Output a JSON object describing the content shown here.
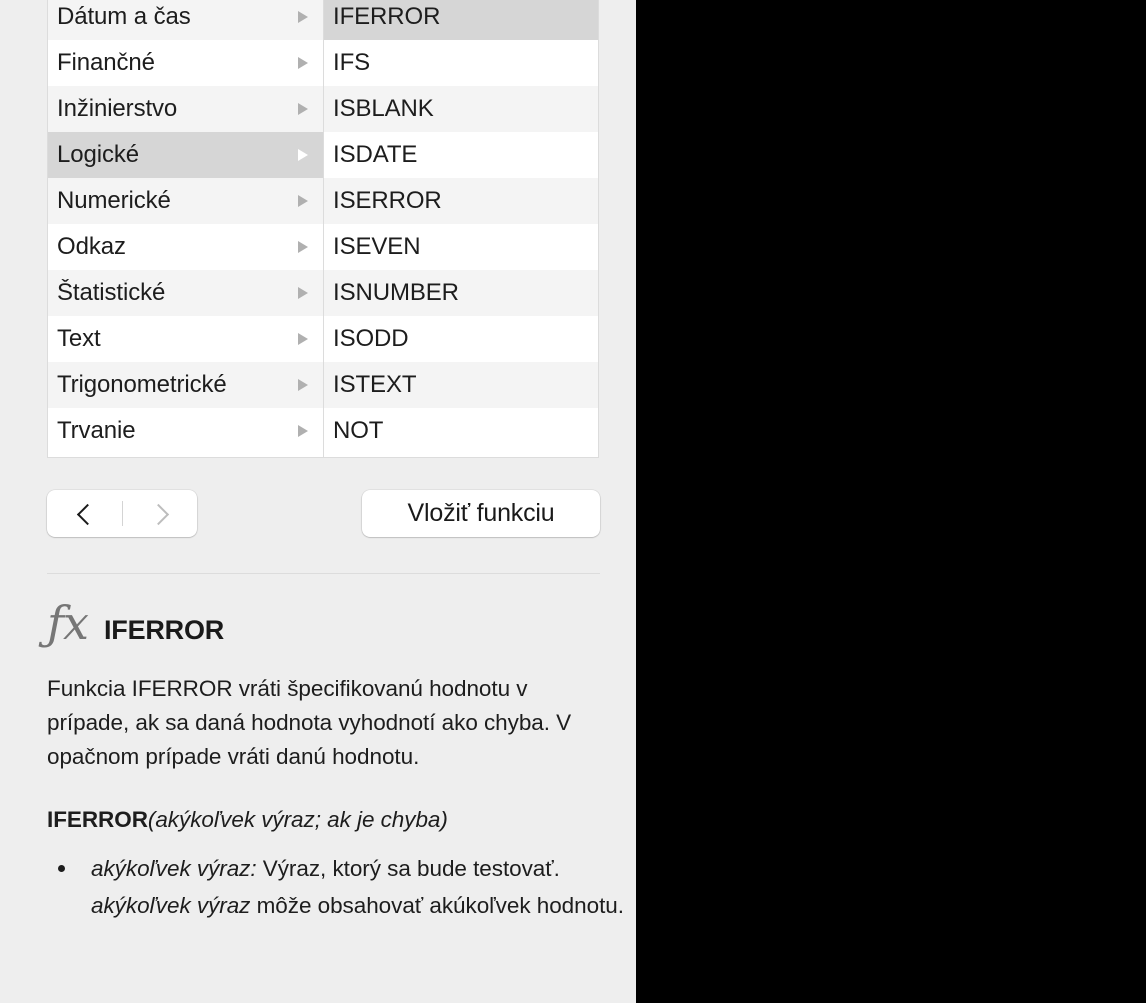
{
  "panel": {
    "background_color": "#eeeeee",
    "outside_color": "#000000"
  },
  "browser": {
    "categories_header": "",
    "categories": [
      {
        "label": "Dátum a čas",
        "selected": false
      },
      {
        "label": "Finančné",
        "selected": false
      },
      {
        "label": "Inžinierstvo",
        "selected": false
      },
      {
        "label": "Logické",
        "selected": true
      },
      {
        "label": "Numerické",
        "selected": false
      },
      {
        "label": "Odkaz",
        "selected": false
      },
      {
        "label": "Štatistické",
        "selected": false
      },
      {
        "label": "Text",
        "selected": false
      },
      {
        "label": "Trigonometrické",
        "selected": false
      },
      {
        "label": "Trvanie",
        "selected": false
      }
    ],
    "functions": [
      {
        "label": "IFERROR",
        "selected": true
      },
      {
        "label": "IFS",
        "selected": false
      },
      {
        "label": "ISBLANK",
        "selected": false
      },
      {
        "label": "ISDATE",
        "selected": false
      },
      {
        "label": "ISERROR",
        "selected": false
      },
      {
        "label": "ISEVEN",
        "selected": false
      },
      {
        "label": "ISNUMBER",
        "selected": false
      },
      {
        "label": "ISODD",
        "selected": false
      },
      {
        "label": "ISTEXT",
        "selected": false
      },
      {
        "label": "NOT",
        "selected": false
      }
    ],
    "selection_color": "#d6d6d6",
    "alt_row_color": "#f4f4f4"
  },
  "controls": {
    "back_icon": "chevron-left-icon",
    "forward_icon": "chevron-right-icon",
    "back_enabled": true,
    "forward_enabled": false,
    "insert_function_label": "Vložiť funkciu"
  },
  "detail": {
    "fx_glyph": "ƒx",
    "function_name": "IFERROR",
    "description": "Funkcia IFERROR vráti špecifikovanú hodnotu v prípade, ak sa daná hodnota vyhodnotí ako chyba. V opačnom prípade vráti danú hodnotu.",
    "syntax": {
      "name": "IFERROR",
      "args": "(akýkoľvek výraz; ak je chyba)"
    },
    "parameters": [
      {
        "term": "akýkoľvek výraz:",
        "text_1": " Výraz, ktorý sa bude testovať. ",
        "term_2": "akýkoľvek výraz",
        "text_2": " môže obsahovať akúkoľvek hodnotu."
      }
    ]
  }
}
